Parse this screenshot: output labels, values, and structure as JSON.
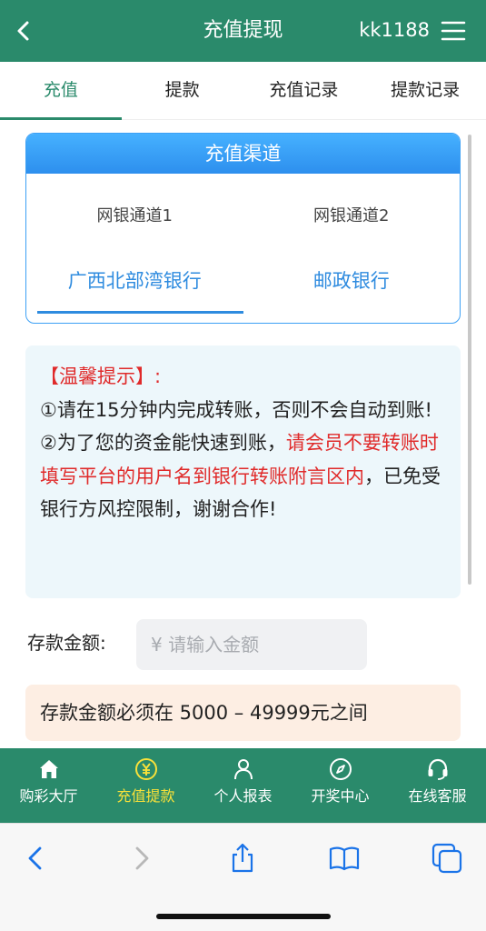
{
  "header": {
    "title": "充值提现",
    "username": "kk1188"
  },
  "tabs": [
    {
      "label": "充值",
      "active": true
    },
    {
      "label": "提款",
      "active": false
    },
    {
      "label": "充值记录",
      "active": false
    },
    {
      "label": "提款记录",
      "active": false
    }
  ],
  "channel": {
    "title": "充值渠道",
    "options": [
      {
        "name": "网银通道1",
        "bank": "广西北部湾银行",
        "selected": true
      },
      {
        "name": "网银通道2",
        "bank": "邮政银行",
        "selected": false
      }
    ]
  },
  "notice": {
    "heading": "【温馨提示】:",
    "line1": "①请在15分钟内完成转账，否则不会自动到账!",
    "line2_prefix": "②为了您的资金能快速到账，",
    "line2_highlight": "请会员不要转账时填写平台的用户名到银行转账附言区内",
    "line2_suffix": "，已免受银行方风控限制，谢谢合作!"
  },
  "deposit": {
    "label": "存款金额:",
    "placeholder": "¥ 请输入金额",
    "value": "",
    "range_text": "存款金额必须在 5000 – 49999元之间"
  },
  "bottom_nav": [
    {
      "label": "购彩大厅",
      "icon": "home-icon",
      "active": false
    },
    {
      "label": "充值提款",
      "icon": "yen-coin-icon",
      "active": true
    },
    {
      "label": "个人报表",
      "icon": "person-icon",
      "active": false
    },
    {
      "label": "开奖中心",
      "icon": "compass-icon",
      "active": false
    },
    {
      "label": "在线客服",
      "icon": "headset-icon",
      "active": false
    }
  ],
  "colors": {
    "primary": "#2a8a6b",
    "accent_blue": "#2e8bdf",
    "warning_red": "#e02a2a",
    "active_nav": "#f8e13a"
  }
}
